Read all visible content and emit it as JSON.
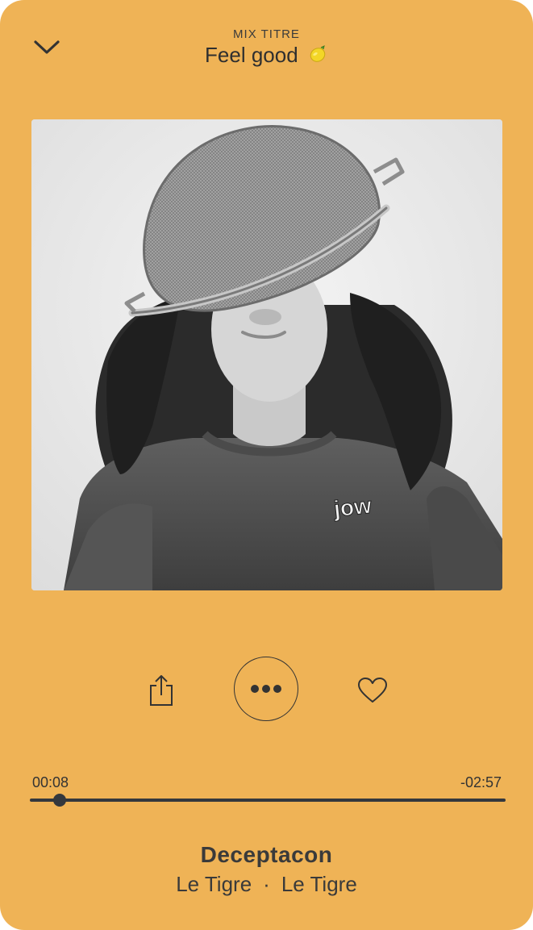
{
  "header": {
    "subtitle": "MIX TITRE",
    "title": "Feel good",
    "title_emoji": "lemon-icon"
  },
  "artwork": {
    "text": "jow"
  },
  "actions": {
    "share_icon": "share-icon",
    "more_icon": "more-dots-icon",
    "like_icon": "heart-icon"
  },
  "playback": {
    "elapsed": "00:08",
    "remaining": "-02:57",
    "progress": 0.063
  },
  "track": {
    "title": "Deceptacon",
    "artist": "Le Tigre",
    "separator": "·",
    "album": "Le Tigre"
  },
  "colors": {
    "background": "#EFB356",
    "text": "#333333",
    "progress": "#34383D"
  }
}
